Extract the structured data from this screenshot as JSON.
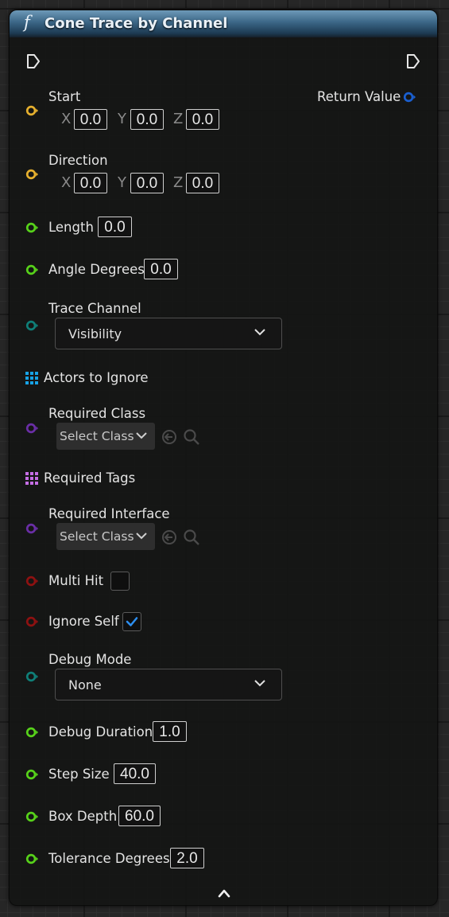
{
  "node": {
    "title": "Cone Trace by Channel",
    "function_glyph": "f",
    "colors": {
      "vector_pin": "#e6b02e",
      "float_pin": "#57d21a",
      "enum_pin": "#0f7f78",
      "object_pin": "#6a2ea6",
      "bool_pin": "#8e1111",
      "return_pin": "#1a5fd0",
      "array_icon": "#17a3e6",
      "set_icon": "#c66ee6",
      "checkbox_check": "#2d8ff0"
    },
    "return_value_label": "Return Value",
    "start": {
      "label": "Start",
      "x": "0.0",
      "y": "0.0",
      "z": "0.0"
    },
    "direction": {
      "label": "Direction",
      "x": "0.0",
      "y": "0.0",
      "z": "0.0"
    },
    "axes": {
      "x": "X",
      "y": "Y",
      "z": "Z"
    },
    "length": {
      "label": "Length",
      "value": "0.0"
    },
    "angle_degrees": {
      "label": "Angle Degrees",
      "value": "0.0"
    },
    "trace_channel": {
      "label": "Trace Channel",
      "selected": "Visibility"
    },
    "actors_to_ignore": {
      "label": "Actors to Ignore"
    },
    "required_class": {
      "label": "Required Class",
      "selected": "Select Class"
    },
    "required_tags": {
      "label": "Required Tags"
    },
    "required_interface": {
      "label": "Required Interface",
      "selected": "Select Class"
    },
    "multi_hit": {
      "label": "Multi Hit",
      "checked": false
    },
    "ignore_self": {
      "label": "Ignore Self",
      "checked": true
    },
    "debug_mode": {
      "label": "Debug Mode",
      "selected": "None"
    },
    "debug_duration": {
      "label": "Debug Duration",
      "value": "1.0"
    },
    "step_size": {
      "label": "Step Size",
      "value": "40.0"
    },
    "box_depth": {
      "label": "Box Depth",
      "value": "60.0"
    },
    "tolerance_degrees": {
      "label": "Tolerance Degrees",
      "value": "2.0"
    }
  }
}
